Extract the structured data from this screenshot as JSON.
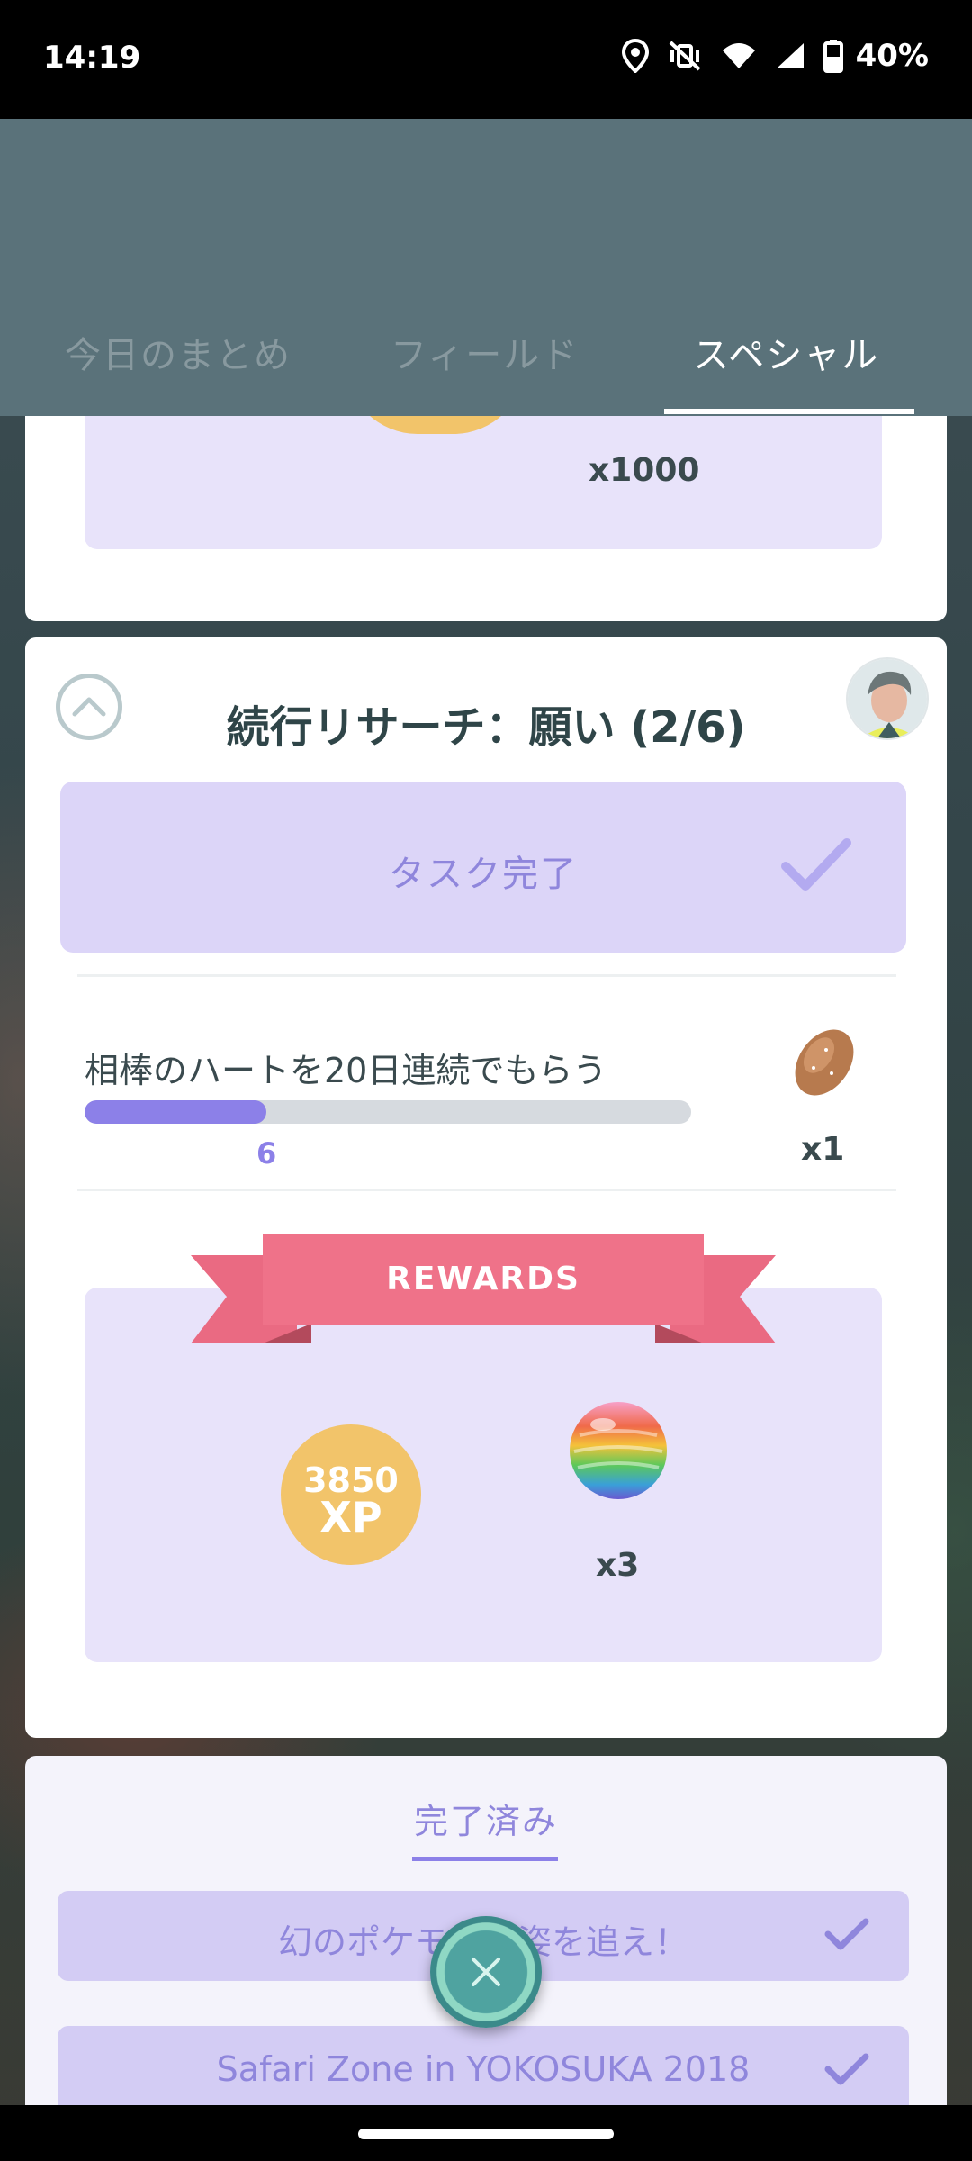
{
  "status_bar": {
    "time": "14:19",
    "battery": "40%",
    "icons": [
      "location-icon",
      "vibrate-off-icon",
      "wifi-icon",
      "cellular-signal-icon",
      "battery-icon"
    ]
  },
  "tabs": [
    {
      "label": "今日のまとめ",
      "active": false
    },
    {
      "label": "フィールド",
      "active": false
    },
    {
      "label": "スペシャル",
      "active": true
    }
  ],
  "previous_card": {
    "reward_quantity": "x1000"
  },
  "research_card": {
    "title": "続行リサーチ：願い (2/6)",
    "task_complete_label": "タスク完了",
    "task": {
      "description": "相棒のハートを20日連続でもらう",
      "progress_value": 6,
      "progress_fraction": 0.3,
      "reward_item": "nanab-berry-icon",
      "reward_quantity": "x1"
    },
    "rewards_banner": "REWARDS",
    "rewards": {
      "xp_amount": "3850",
      "xp_unit": "XP",
      "item": "rare-candy-icon",
      "item_quantity": "x3"
    }
  },
  "completed_section": {
    "tab_label": "完了済み",
    "items": [
      {
        "label": "幻のポケモンの姿を追え！"
      },
      {
        "label": "Safari Zone in YOKOSUKA 2018"
      }
    ]
  },
  "colors": {
    "header": "#5a727a",
    "accent_purple": "#8c80e8",
    "panel_purple": "#e8e3fa",
    "banner_pink": "#ee6f86",
    "xp_gold": "#f2c46a"
  }
}
